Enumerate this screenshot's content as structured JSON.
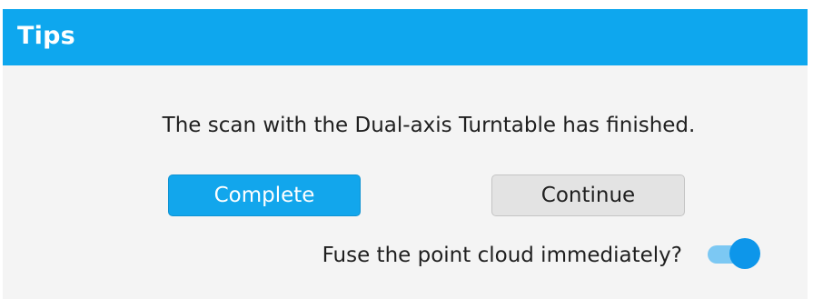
{
  "dialog": {
    "title": "Tips",
    "message": "The scan with the Dual-axis Turntable has finished.",
    "buttons": {
      "complete_label": "Complete",
      "continue_label": "Continue"
    },
    "fuse_option": {
      "label": "Fuse the point cloud immediately?",
      "enabled": true
    }
  },
  "colors": {
    "title_bar": "#0ea7ee",
    "primary_button": "#12a6ec",
    "secondary_button": "#e3e3e3",
    "toggle_on": "#0d96ea"
  }
}
